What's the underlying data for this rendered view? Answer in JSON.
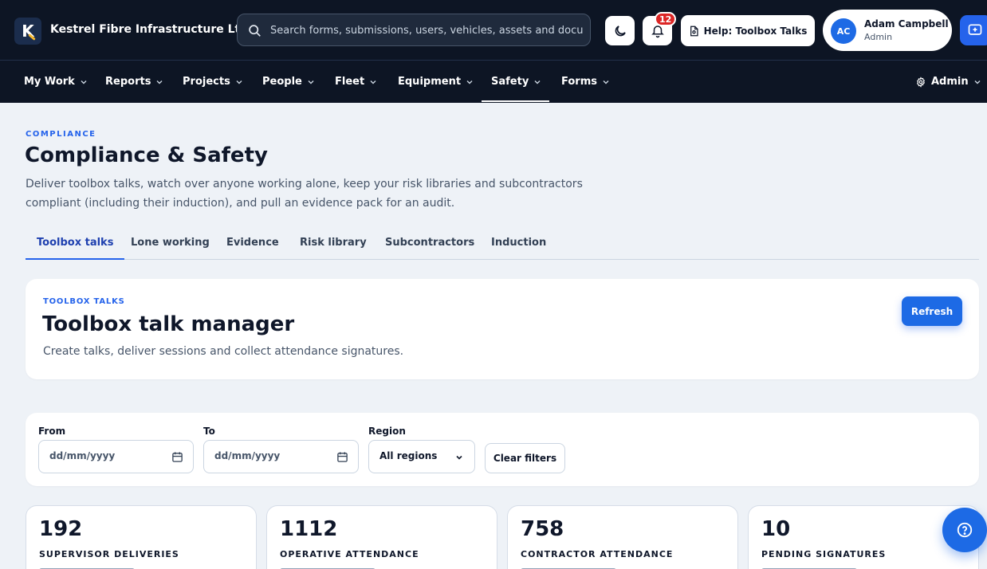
{
  "header": {
    "logo_letter": "K",
    "company": "Kestrel Fibre Infrastructure Ltd",
    "search_placeholder": "Search forms, submissions, users, vehicles, assets and docu",
    "notification_count": "12",
    "help_label": "Help: Toolbox Talks",
    "user": {
      "initials": "AC",
      "name": "Adam Campbell",
      "role": "Admin"
    }
  },
  "nav": {
    "items": [
      {
        "label": "My Work"
      },
      {
        "label": "Reports"
      },
      {
        "label": "Projects"
      },
      {
        "label": "People"
      },
      {
        "label": "Fleet"
      },
      {
        "label": "Equipment"
      },
      {
        "label": "Safety"
      },
      {
        "label": "Forms"
      }
    ],
    "active": "Safety",
    "admin_label": "Admin"
  },
  "page": {
    "eyebrow": "COMPLIANCE",
    "title": "Compliance & Safety",
    "description": "Deliver toolbox talks, watch over anyone working alone, keep your risk libraries and subcontractors compliant (including their induction), and pull an evidence pack for an audit."
  },
  "tabs": {
    "items": [
      "Toolbox talks",
      "Lone working",
      "Evidence",
      "Risk library",
      "Subcontractors",
      "Induction"
    ],
    "active": "Toolbox talks"
  },
  "manager": {
    "eyebrow": "TOOLBOX TALKS",
    "title": "Toolbox talk manager",
    "description": "Create talks, deliver sessions and collect attendance signatures.",
    "refresh_label": "Refresh"
  },
  "filters": {
    "from_label": "From",
    "from_placeholder": "dd/mm/yyyy",
    "to_label": "To",
    "to_placeholder": "dd/mm/yyyy",
    "region_label": "Region",
    "region_value": "All regions",
    "clear_label": "Clear filters"
  },
  "stats": [
    {
      "value": "192",
      "label": "SUPERVISOR DELIVERIES"
    },
    {
      "value": "1112",
      "label": "OPERATIVE ATTENDANCE"
    },
    {
      "value": "758",
      "label": "CONTRACTOR ATTENDANCE"
    },
    {
      "value": "10",
      "label": "PENDING SIGNATURES"
    }
  ],
  "colors": {
    "header_bg": "#0d1524",
    "accent": "#2563eb",
    "badge": "#dc2626",
    "page_bg": "#eef2f7"
  }
}
